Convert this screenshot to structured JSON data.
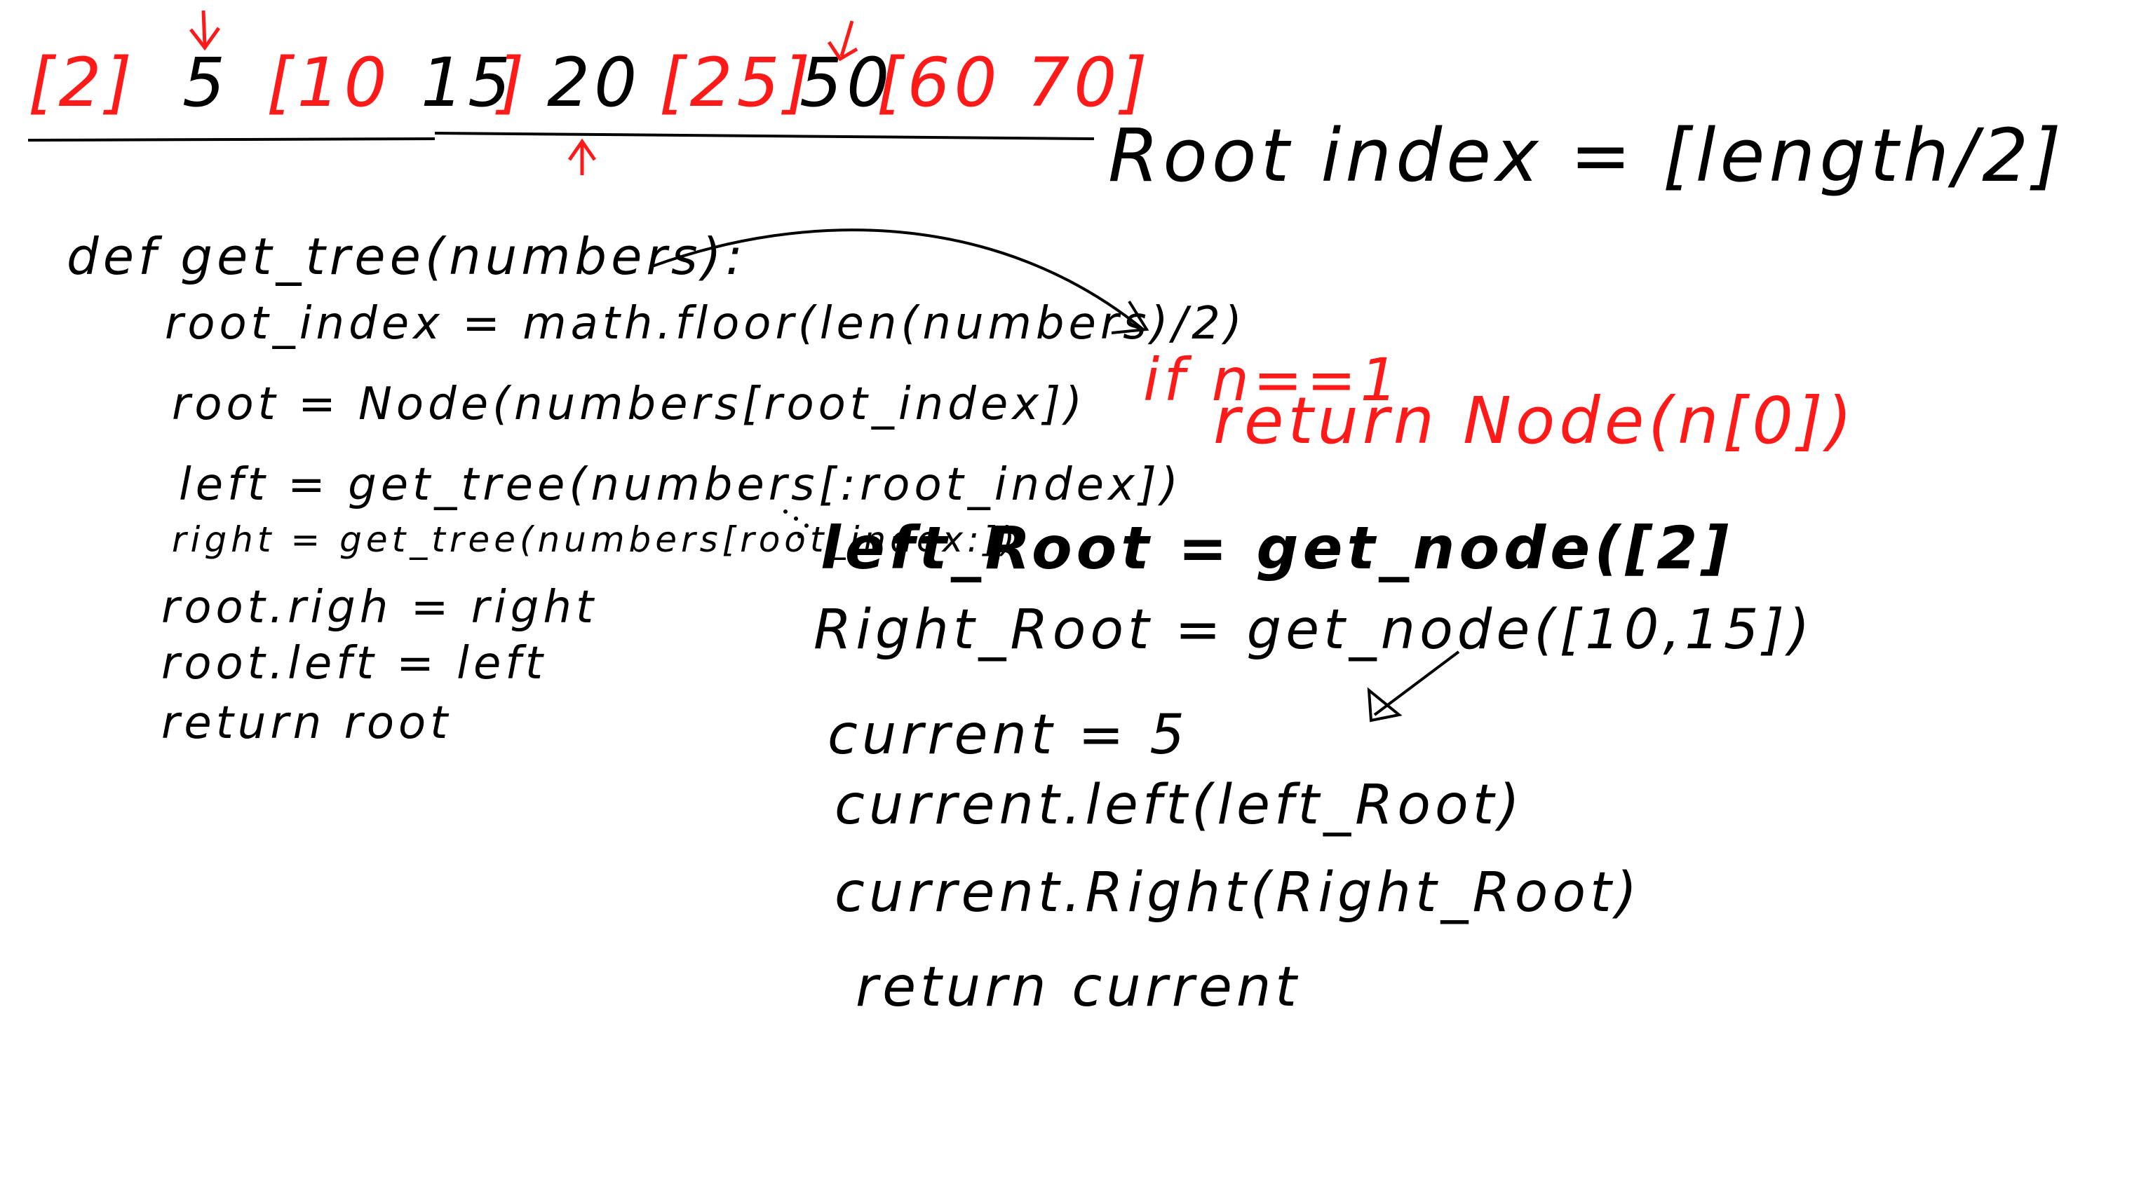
{
  "canvas": {
    "background": "#ffffff"
  },
  "colors": {
    "ink": "#000000",
    "highlight": "#ff1a1a"
  },
  "array": [
    {
      "text": "[2]",
      "color": "red"
    },
    {
      "text": "5",
      "color": "black"
    },
    {
      "text": "[10",
      "color": "red"
    },
    {
      "text": "15",
      "color": "black"
    },
    {
      "text": "]",
      "color": "red"
    },
    {
      "text": "20",
      "color": "black"
    },
    {
      "text": "[25]",
      "color": "red"
    },
    {
      "text": "50",
      "color": "black"
    },
    {
      "text": "[60 70]",
      "color": "red"
    }
  ],
  "root_formula": "Root index = [length/2]",
  "code": {
    "lines": [
      "def get_tree(numbers):",
      "root_index = math.floor(len(numbers)/2)",
      "root = Node(numbers[root_index])",
      "left = get_tree(numbers[:root_index])",
      "right = get_tree(numbers[root_index:])",
      "root.righ = right",
      "root.left = left",
      "return root"
    ]
  },
  "base_case": {
    "line1": "if n==1",
    "line2": "return Node(n[0])"
  },
  "trace": {
    "lines": [
      "left_Root = get_node([2]",
      "Right_Root = get_node([10,15])",
      "current = 5",
      "current.left(left_Root)",
      "current.Right(Right_Root)",
      "return current"
    ]
  }
}
